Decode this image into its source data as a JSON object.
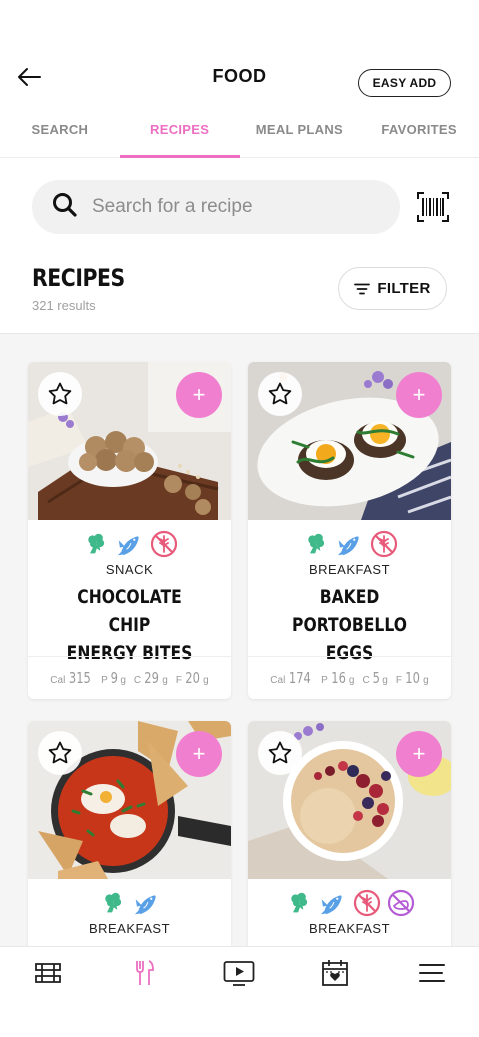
{
  "header": {
    "title": "FOOD",
    "easy_add_label": "EASY ADD"
  },
  "tabs": [
    {
      "label": "SEARCH",
      "active": false
    },
    {
      "label": "RECIPES",
      "active": true
    },
    {
      "label": "MEAL PLANS",
      "active": false
    },
    {
      "label": "FAVORITES",
      "active": false
    }
  ],
  "search": {
    "placeholder": "Search for a recipe"
  },
  "recipes": {
    "title": "RECIPES",
    "count": "321 results",
    "filter_label": "FILTER"
  },
  "cards": [
    {
      "category": "SNACK",
      "name_line1": "CHOCOLATE CHIP",
      "name_line2": "ENERGY BITES",
      "icons": [
        "broccoli-icon",
        "fish-icon",
        "no-wheat-icon"
      ],
      "cal": "315",
      "p": "9",
      "c": "29",
      "f": "20"
    },
    {
      "category": "BREAKFAST",
      "name_line1": "BAKED PORTOBELLO",
      "name_line2": "EGGS",
      "icons": [
        "broccoli-icon",
        "fish-icon",
        "no-wheat-icon"
      ],
      "cal": "174",
      "p": "16",
      "c": "5",
      "f": "10"
    },
    {
      "category": "BREAKFAST",
      "name_line1": "",
      "name_line2": "",
      "icons": [
        "broccoli-icon",
        "fish-icon"
      ]
    },
    {
      "category": "BREAKFAST",
      "name_line1": "",
      "name_line2": "",
      "icons": [
        "broccoli-icon",
        "fish-icon",
        "no-wheat-icon",
        "no-dairy-icon"
      ]
    }
  ],
  "macro_labels": {
    "cal": "Cal",
    "p": "P",
    "c": "C",
    "f": "F",
    "unit": "g"
  },
  "colors": {
    "accent": "#ec6fc2",
    "plus": "#f17fcf",
    "veg_green": "#3fb88a",
    "fish_blue": "#5aa0e6",
    "wheat_red": "#e85a7a",
    "dairy_purple": "#b45cd6"
  },
  "bottom_nav": [
    "workout-icon",
    "food-icon",
    "video-icon",
    "calendar-icon",
    "menu-icon"
  ]
}
